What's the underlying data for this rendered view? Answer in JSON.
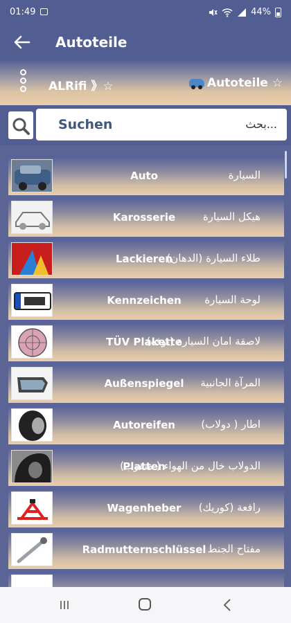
{
  "status": {
    "time": "01:49",
    "battery": "44%"
  },
  "app_bar": {
    "title": "Autoteile"
  },
  "hero": {
    "crumb_left": "ALRifi 》☆",
    "crumb_right": "Autoteile ☆"
  },
  "search": {
    "label": "Suchen",
    "hint": "بحث..."
  },
  "items": [
    {
      "de": "Auto",
      "ar": "السيارة"
    },
    {
      "de": "Karosserie",
      "ar": "هيكل السيارة"
    },
    {
      "de": "Lackieren",
      "ar": "طلاء السيارة (الدهان)"
    },
    {
      "de": "Kennzeichen",
      "ar": "لوحة السيارة"
    },
    {
      "de": "TÜV Plakette",
      "ar": "لاصقة امان السيارة (توف)"
    },
    {
      "de": "Außenspiegel",
      "ar": "المرآة الجانبية"
    },
    {
      "de": "Autoreifen",
      "ar": "اطار ( دولاب)"
    },
    {
      "de": "Platten",
      "ar": "الدولاب  خال من الهواء ( متقوب)"
    },
    {
      "de": "Wagenheber",
      "ar": "رافعة (كوريك)"
    },
    {
      "de": "Radmutternschlüssel",
      "ar": "مفتاح الجنط"
    }
  ]
}
